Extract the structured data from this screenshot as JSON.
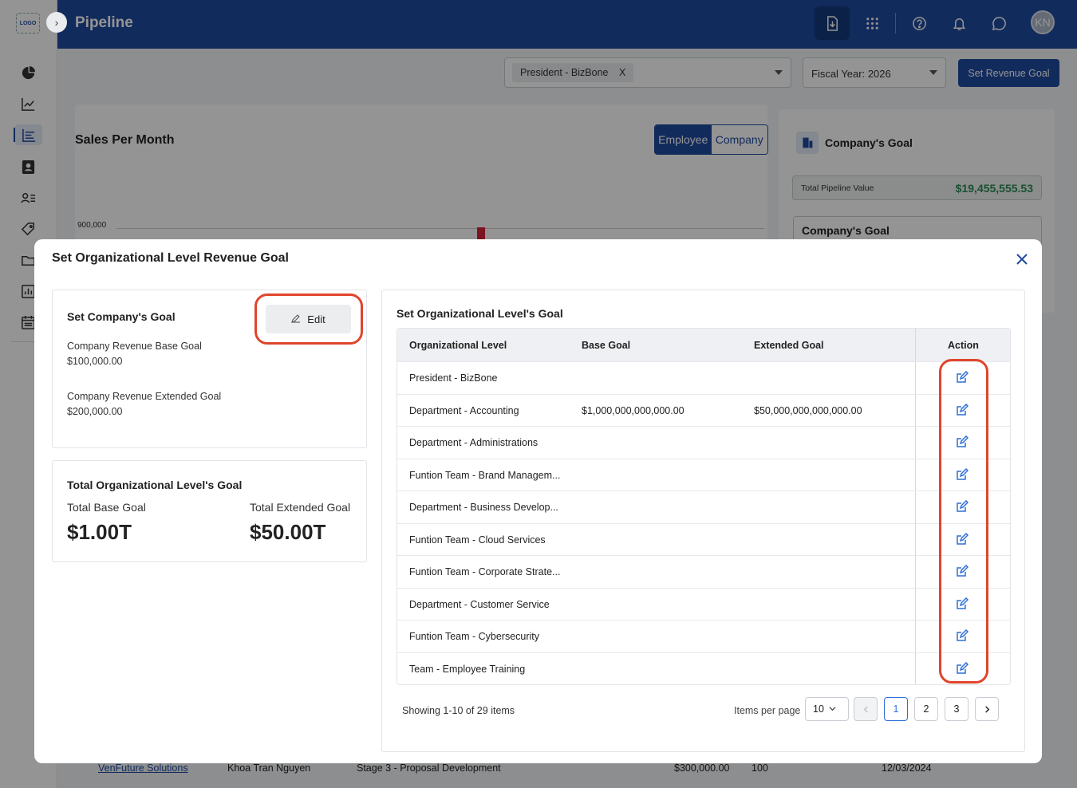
{
  "app": {
    "title": "Pipeline",
    "logo_text": "LOGO",
    "avatar_initials": "KN"
  },
  "filters": {
    "org_chip": "President - BizBone",
    "chip_remove": "X",
    "fiscal_year": "Fiscal Year: 2026",
    "set_revenue_goal": "Set Revenue Goal"
  },
  "background": {
    "sales_title": "Sales Per Month",
    "toggle_employee": "Employee",
    "toggle_company": "Company",
    "y_tick": "900,000",
    "company_goal_card_title": "Company's Goal",
    "pipeline_label": "Total Pipeline Value",
    "pipeline_value": "$19,455,555.53",
    "company_goal_sub": "Company's Goal",
    "bg_row": {
      "company": "VenFuture Solutions",
      "owner": "Khoa Tran Nguyen",
      "stage": "Stage 3 - Proposal Development",
      "amount": "$300,000.00",
      "probability": "100",
      "date": "12/03/2024"
    }
  },
  "modal": {
    "title": "Set Organizational Level Revenue Goal",
    "company_goal": {
      "title": "Set Company's Goal",
      "edit_label": "Edit",
      "base_label": "Company Revenue Base Goal",
      "base_value": "$100,000.00",
      "extended_label": "Company Revenue Extended Goal",
      "extended_value": "$200,000.00"
    },
    "totals": {
      "title": "Total Organizational Level's Goal",
      "base_label": "Total Base Goal",
      "base_value": "$1.00T",
      "extended_label": "Total Extended Goal",
      "extended_value": "$50.00T"
    },
    "org_table": {
      "title": "Set Organizational Level's Goal",
      "headers": [
        "Organizational Level",
        "Base Goal",
        "Extended Goal",
        "Action"
      ],
      "rows": [
        {
          "level": "President - BizBone",
          "base": "",
          "extended": ""
        },
        {
          "level": "Department - Accounting",
          "base": "$1,000,000,000,000.00",
          "extended": "$50,000,000,000,000.00"
        },
        {
          "level": "Department - Administrations",
          "base": "",
          "extended": ""
        },
        {
          "level": "Funtion Team - Brand Managem...",
          "base": "",
          "extended": ""
        },
        {
          "level": "Department - Business Develop...",
          "base": "",
          "extended": ""
        },
        {
          "level": "Funtion Team - Cloud Services",
          "base": "",
          "extended": ""
        },
        {
          "level": "Funtion Team - Corporate Strate...",
          "base": "",
          "extended": ""
        },
        {
          "level": "Department - Customer Service",
          "base": "",
          "extended": ""
        },
        {
          "level": "Funtion Team - Cybersecurity",
          "base": "",
          "extended": ""
        },
        {
          "level": "Team - Employee Training",
          "base": "",
          "extended": ""
        }
      ]
    },
    "pagination": {
      "showing": "Showing 1-10 of 29 items",
      "items_per_page_label": "Items per page",
      "items_per_page_value": "10",
      "pages": [
        "1",
        "2",
        "3"
      ],
      "current_page": "1"
    }
  },
  "colors": {
    "primary": "#1f4aa0",
    "accent_blue": "#2f6fd6",
    "highlight": "#e0452c",
    "positive": "#2e8b57"
  },
  "icons": [
    "expand-icon",
    "pie-chart-icon",
    "line-chart-icon",
    "bar-chart-icon",
    "contacts-icon",
    "users-list-icon",
    "tag-icon",
    "folder-icon",
    "report-icon",
    "calendar-icon",
    "download-icon",
    "apps-grid-icon",
    "help-icon",
    "bell-icon",
    "chat-icon",
    "building-icon",
    "close-icon",
    "pencil-icon",
    "edit-icon",
    "chevron-down-icon",
    "chevron-left-icon",
    "chevron-right-icon"
  ]
}
